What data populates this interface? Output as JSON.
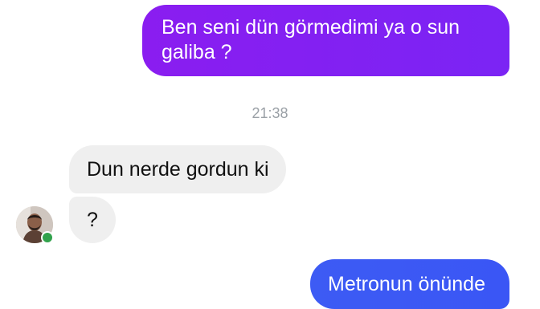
{
  "colors": {
    "sent_bubble_purple": "#8a1df0",
    "sent_bubble_blue": "#3d5bf4",
    "received_bubble": "#efefef",
    "timestamp_text": "#9aa0a6",
    "online_indicator": "#31a24c"
  },
  "conversation": {
    "messages": [
      {
        "direction": "sent",
        "text": "Ben seni dün görmedimi ya o sun galiba ?"
      },
      {
        "direction": "received",
        "text": "Dun nerde gordun ki"
      },
      {
        "direction": "received",
        "text": "?"
      },
      {
        "direction": "sent",
        "text": "Metronun önünde"
      }
    ],
    "timestamp": "21:38"
  },
  "contact": {
    "avatar_icon": "profile-photo-icon",
    "status_icon": "online-status-dot-icon"
  }
}
